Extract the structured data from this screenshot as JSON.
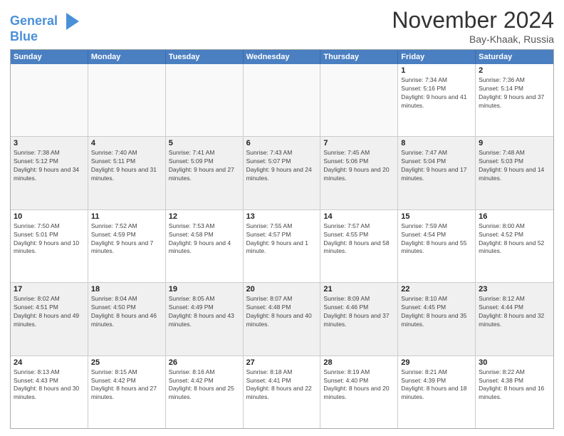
{
  "header": {
    "logo_line1": "General",
    "logo_line2": "Blue",
    "month_title": "November 2024",
    "location": "Bay-Khaak, Russia"
  },
  "days_of_week": [
    "Sunday",
    "Monday",
    "Tuesday",
    "Wednesday",
    "Thursday",
    "Friday",
    "Saturday"
  ],
  "rows": [
    [
      {
        "day": "",
        "empty": true
      },
      {
        "day": "",
        "empty": true
      },
      {
        "day": "",
        "empty": true
      },
      {
        "day": "",
        "empty": true
      },
      {
        "day": "",
        "empty": true
      },
      {
        "day": "1",
        "info": "Sunrise: 7:34 AM\nSunset: 5:16 PM\nDaylight: 9 hours and 41 minutes."
      },
      {
        "day": "2",
        "info": "Sunrise: 7:36 AM\nSunset: 5:14 PM\nDaylight: 9 hours and 37 minutes."
      }
    ],
    [
      {
        "day": "3",
        "info": "Sunrise: 7:38 AM\nSunset: 5:12 PM\nDaylight: 9 hours and 34 minutes."
      },
      {
        "day": "4",
        "info": "Sunrise: 7:40 AM\nSunset: 5:11 PM\nDaylight: 9 hours and 31 minutes."
      },
      {
        "day": "5",
        "info": "Sunrise: 7:41 AM\nSunset: 5:09 PM\nDaylight: 9 hours and 27 minutes."
      },
      {
        "day": "6",
        "info": "Sunrise: 7:43 AM\nSunset: 5:07 PM\nDaylight: 9 hours and 24 minutes."
      },
      {
        "day": "7",
        "info": "Sunrise: 7:45 AM\nSunset: 5:06 PM\nDaylight: 9 hours and 20 minutes."
      },
      {
        "day": "8",
        "info": "Sunrise: 7:47 AM\nSunset: 5:04 PM\nDaylight: 9 hours and 17 minutes."
      },
      {
        "day": "9",
        "info": "Sunrise: 7:48 AM\nSunset: 5:03 PM\nDaylight: 9 hours and 14 minutes."
      }
    ],
    [
      {
        "day": "10",
        "info": "Sunrise: 7:50 AM\nSunset: 5:01 PM\nDaylight: 9 hours and 10 minutes."
      },
      {
        "day": "11",
        "info": "Sunrise: 7:52 AM\nSunset: 4:59 PM\nDaylight: 9 hours and 7 minutes."
      },
      {
        "day": "12",
        "info": "Sunrise: 7:53 AM\nSunset: 4:58 PM\nDaylight: 9 hours and 4 minutes."
      },
      {
        "day": "13",
        "info": "Sunrise: 7:55 AM\nSunset: 4:57 PM\nDaylight: 9 hours and 1 minute."
      },
      {
        "day": "14",
        "info": "Sunrise: 7:57 AM\nSunset: 4:55 PM\nDaylight: 8 hours and 58 minutes."
      },
      {
        "day": "15",
        "info": "Sunrise: 7:59 AM\nSunset: 4:54 PM\nDaylight: 8 hours and 55 minutes."
      },
      {
        "day": "16",
        "info": "Sunrise: 8:00 AM\nSunset: 4:52 PM\nDaylight: 8 hours and 52 minutes."
      }
    ],
    [
      {
        "day": "17",
        "info": "Sunrise: 8:02 AM\nSunset: 4:51 PM\nDaylight: 8 hours and 49 minutes."
      },
      {
        "day": "18",
        "info": "Sunrise: 8:04 AM\nSunset: 4:50 PM\nDaylight: 8 hours and 46 minutes."
      },
      {
        "day": "19",
        "info": "Sunrise: 8:05 AM\nSunset: 4:49 PM\nDaylight: 8 hours and 43 minutes."
      },
      {
        "day": "20",
        "info": "Sunrise: 8:07 AM\nSunset: 4:48 PM\nDaylight: 8 hours and 40 minutes."
      },
      {
        "day": "21",
        "info": "Sunrise: 8:09 AM\nSunset: 4:46 PM\nDaylight: 8 hours and 37 minutes."
      },
      {
        "day": "22",
        "info": "Sunrise: 8:10 AM\nSunset: 4:45 PM\nDaylight: 8 hours and 35 minutes."
      },
      {
        "day": "23",
        "info": "Sunrise: 8:12 AM\nSunset: 4:44 PM\nDaylight: 8 hours and 32 minutes."
      }
    ],
    [
      {
        "day": "24",
        "info": "Sunrise: 8:13 AM\nSunset: 4:43 PM\nDaylight: 8 hours and 30 minutes."
      },
      {
        "day": "25",
        "info": "Sunrise: 8:15 AM\nSunset: 4:42 PM\nDaylight: 8 hours and 27 minutes."
      },
      {
        "day": "26",
        "info": "Sunrise: 8:16 AM\nSunset: 4:42 PM\nDaylight: 8 hours and 25 minutes."
      },
      {
        "day": "27",
        "info": "Sunrise: 8:18 AM\nSunset: 4:41 PM\nDaylight: 8 hours and 22 minutes."
      },
      {
        "day": "28",
        "info": "Sunrise: 8:19 AM\nSunset: 4:40 PM\nDaylight: 8 hours and 20 minutes."
      },
      {
        "day": "29",
        "info": "Sunrise: 8:21 AM\nSunset: 4:39 PM\nDaylight: 8 hours and 18 minutes."
      },
      {
        "day": "30",
        "info": "Sunrise: 8:22 AM\nSunset: 4:38 PM\nDaylight: 8 hours and 16 minutes."
      }
    ]
  ]
}
